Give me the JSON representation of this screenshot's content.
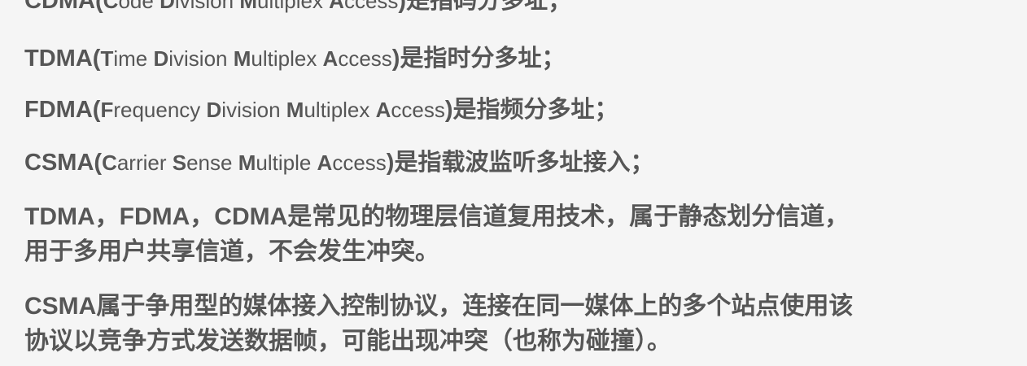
{
  "definitions": [
    {
      "acronym": "CDMA",
      "open": "(",
      "parts": [
        "C",
        "ode ",
        "D",
        "ivision ",
        "M",
        "ultiplex ",
        "A",
        "ccess"
      ],
      "close": ")",
      "meaning": "是指码分多址；"
    },
    {
      "acronym": "TDMA",
      "open": "(",
      "parts": [
        "T",
        "ime ",
        "D",
        "ivision ",
        "M",
        "ultiplex ",
        "A",
        "ccess"
      ],
      "close": ")",
      "meaning": "是指时分多址；"
    },
    {
      "acronym": "FDMA",
      "open": "(",
      "parts": [
        "F",
        "requency ",
        "D",
        "ivision ",
        "M",
        "ultiplex ",
        "A",
        "ccess"
      ],
      "close": ")",
      "meaning": "是指频分多址；"
    },
    {
      "acronym": "CSMA",
      "open": "(",
      "parts": [
        "C",
        "arrier ",
        "S",
        "ense ",
        "M",
        "ultiple ",
        "A",
        "ccess"
      ],
      "close": ")",
      "meaning": "是指载波监听多址接入；"
    }
  ],
  "paragraphs": [
    {
      "line1": "TDMA，FDMA，CDMA是常见的物理层信道复用技术，属于静态划分信道，",
      "line2": "用于多用户共享信道，不会发生冲突。"
    },
    {
      "line1": "CSMA属于争用型的媒体接入控制协议，连接在同一媒体上的多个站点使用该",
      "line2": "协议以竞争方式发送数据帧，可能出现冲突（也称为碰撞）。"
    }
  ]
}
